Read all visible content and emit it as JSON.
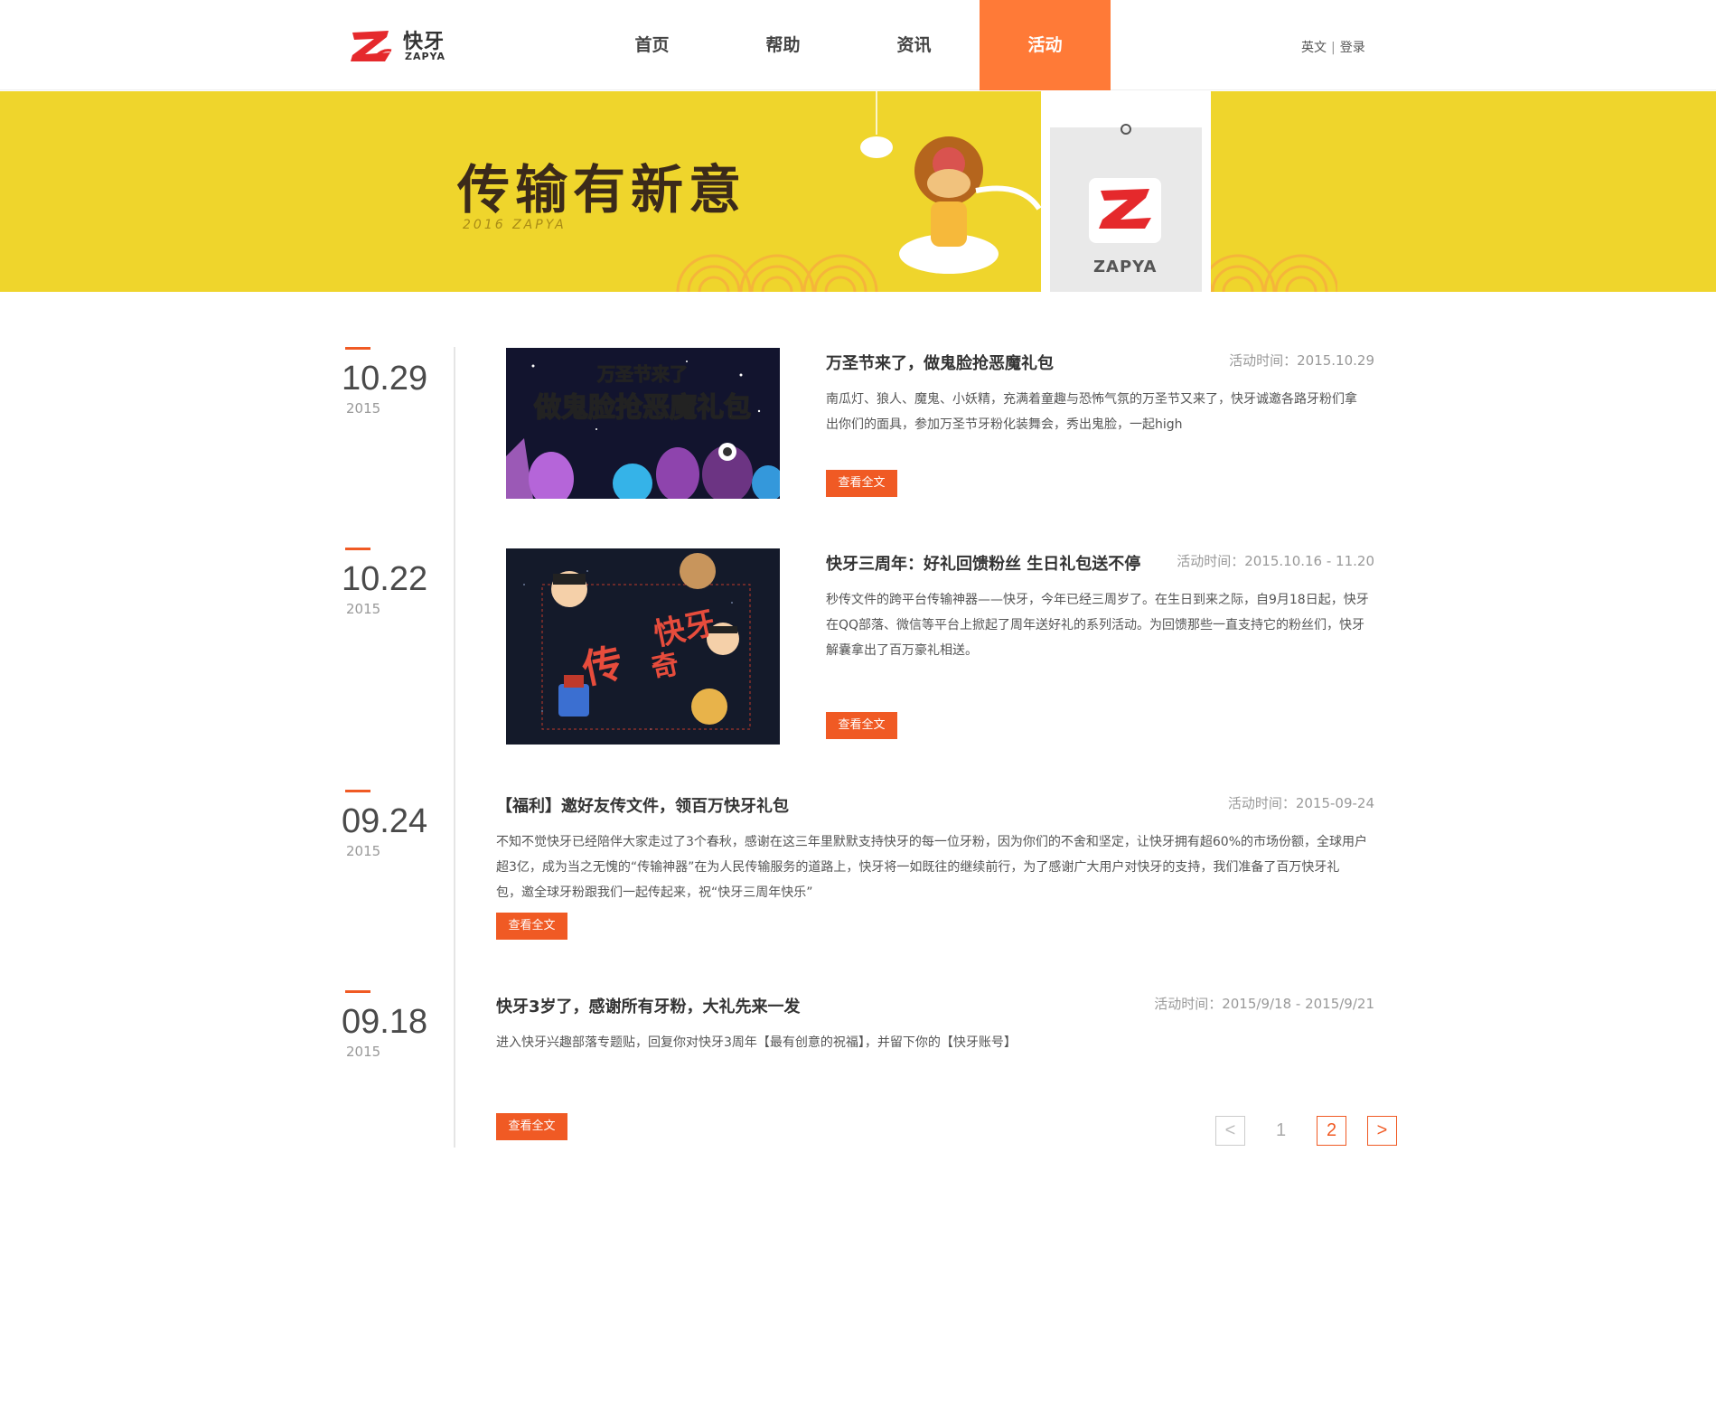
{
  "header": {
    "logo_cn": "快牙",
    "logo_en": "ZAPYA",
    "nav": [
      {
        "label": "首页",
        "active": false
      },
      {
        "label": "帮助",
        "active": false
      },
      {
        "label": "资讯",
        "active": false
      },
      {
        "label": "活动",
        "active": true
      }
    ],
    "lang_link": "英文",
    "separator": "|",
    "login_link": "登录"
  },
  "banner": {
    "title": "传输有新意",
    "subtitle": "2016 ZAPYA",
    "phone_brand": "ZAPYA",
    "bg_color": "#efd52c"
  },
  "accent_color": "#f05a24",
  "nav_active_color": "#ff7a37",
  "entries": [
    {
      "day": "10.29",
      "year": "2015",
      "title": "万圣节来了，做鬼脸抢恶魔礼包",
      "time": "活动时间：2015.10.29",
      "desc": [
        "南瓜灯、狼人、魔鬼、小妖精，充满着童趣与恐怖气氛的万圣节又来了，快牙诚邀各路牙粉们拿",
        "出你们的面具，参加万圣节牙粉化装舞会，秀出鬼脸，一起high"
      ],
      "button": "查看全文",
      "image_text": [
        "万圣节来了",
        "做鬼脸抢恶魔礼包"
      ]
    },
    {
      "day": "10.22",
      "year": "2015",
      "title": "快牙三周年：好礼回馈粉丝 生日礼包送不停",
      "time": "活动时间：2015.10.16 - 11.20",
      "desc": [
        "秒传文件的跨平台传输神器——快牙，今年已经三周岁了。在生日到来之际，自9月18日起，快牙",
        "在QQ部落、微信等平台上掀起了周年送好礼的系列活动。为回馈那些一直支持它的粉丝们，快牙",
        "解囊拿出了百万豪礼相送。"
      ],
      "button": "查看全文",
      "image_text": [
        "快牙",
        "传",
        "奇"
      ]
    },
    {
      "day": "09.24",
      "year": "2015",
      "title": "【福利】邀好友传文件，领百万快牙礼包",
      "time": "活动时间：2015-09-24",
      "desc": [
        "不知不觉快牙已经陪伴大家走过了3个春秋，感谢在这三年里默默支持快牙的每一位牙粉，因为你们的不舍和坚定，让快牙拥有超60%的市场份额，全球用户",
        "超3亿，成为当之无愧的“传输神器”在为人民传输服务的道路上，快牙将一如既往的继续前行，为了感谢广大用户对快牙的支持，我们准备了百万快牙礼",
        "包，邀全球牙粉跟我们一起传起来，祝“快牙三周年快乐”"
      ],
      "button": "查看全文"
    },
    {
      "day": "09.18",
      "year": "2015",
      "title": "快牙3岁了，感谢所有牙粉，大礼先来一发",
      "time": "活动时间：2015/9/18 - 2015/9/21",
      "desc": [
        "进入快牙兴趣部落专题贴，回复你对快牙3周年【最有创意的祝福】，并留下你的【快牙账号】"
      ],
      "button": "查看全文"
    }
  ],
  "pagination": {
    "prev": "<",
    "pages": [
      "1",
      "2"
    ],
    "current": "2",
    "next": ">"
  }
}
